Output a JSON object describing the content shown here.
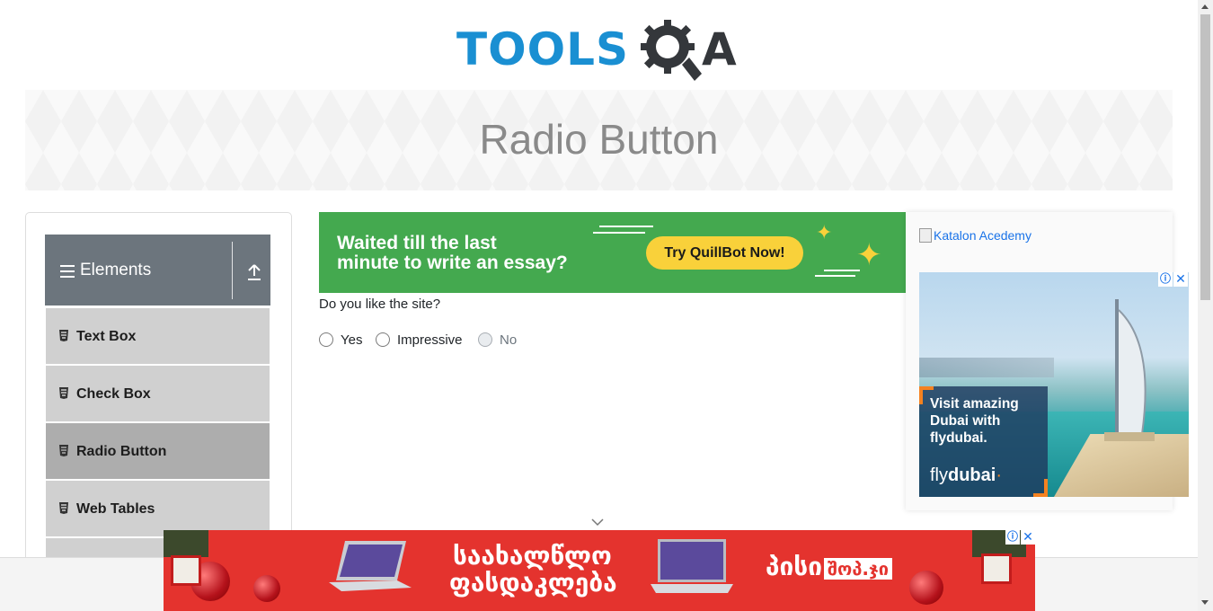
{
  "header": {
    "logo_main": "TOOLS",
    "logo_end": "A"
  },
  "banner": {
    "title": "Radio Button"
  },
  "sidebar": {
    "group_title": "Elements",
    "items": [
      {
        "label": "Text Box"
      },
      {
        "label": "Check Box"
      },
      {
        "label": "Radio Button",
        "active": true
      },
      {
        "label": "Web Tables"
      }
    ]
  },
  "ad_top": {
    "headline_line1": "Waited till the last",
    "headline_line2": "minute to write an essay?",
    "cta": "Try QuillBot Now!",
    "bg_color": "#44a94f",
    "cta_color": "#f9d13a"
  },
  "form": {
    "question": "Do you like the site?",
    "options": [
      {
        "label": "Yes",
        "checked": false,
        "disabled": false
      },
      {
        "label": "Impressive",
        "checked": false,
        "disabled": false
      },
      {
        "label": "No",
        "checked": false,
        "disabled": true
      }
    ]
  },
  "right_col": {
    "katalon_alt": "Katalon Acedemy",
    "dubai_ad": {
      "text": "Visit amazing Dubai with flydubai.",
      "brand_main": "fly",
      "brand_end": "dubai",
      "adchoice_icon": "ⓘ",
      "close_icon": "✕"
    }
  },
  "ad_bottom": {
    "text_line1": "საახალწლო",
    "text_line2": "ფასდაკლება",
    "brand": "პისი",
    "brand_sub": "შოპ.ჯი",
    "bg_color": "#e4332e",
    "adchoice_icon": "ⓘ",
    "close_icon": "✕"
  },
  "colors": {
    "accent": "#1a8fd2",
    "sidebar_head": "#6c757d",
    "sidebar_item": "#d0d0d0",
    "sidebar_item_active": "#adadad"
  }
}
